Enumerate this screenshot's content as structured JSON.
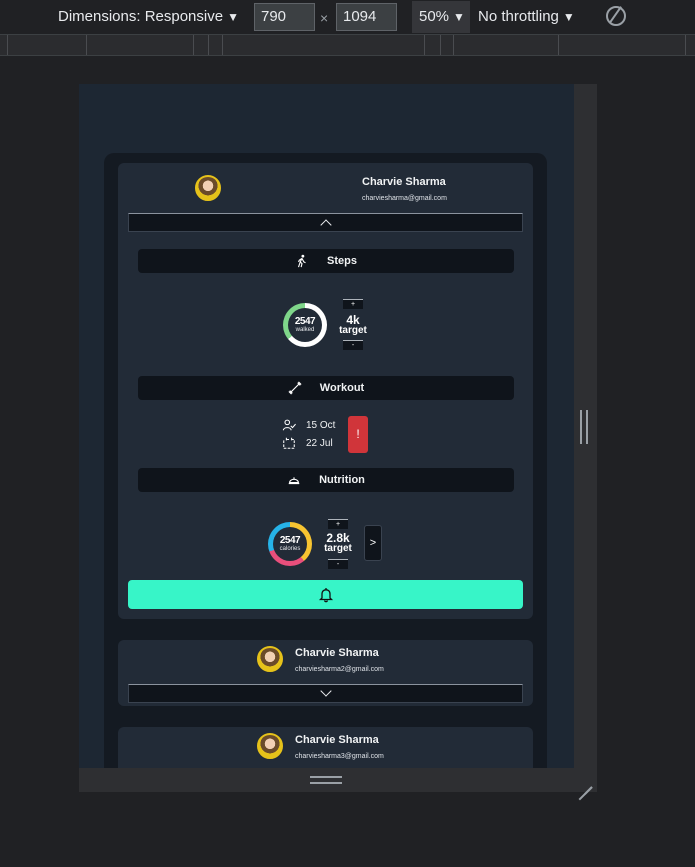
{
  "devtools": {
    "dimensions_label": "Dimensions: Responsive",
    "width": "790",
    "height": "1094",
    "times": "×",
    "zoom": "50%",
    "throttling": "No throttling",
    "caret": "▼"
  },
  "cards": [
    {
      "name": "Charvie Sharma",
      "email": "charviesharma@gmail.com",
      "expanded": true,
      "steps": {
        "title": "Steps",
        "walked_value": "2547",
        "walked_label": "walked",
        "progress": 0.64,
        "plus": "+",
        "minus": "-",
        "target_value": "4k",
        "target_label": "target"
      },
      "workout": {
        "title": "Workout",
        "date1": "15 Oct",
        "date2": "22 Jul",
        "alert": "!"
      },
      "nutrition": {
        "title": "Nutrition",
        "calories_value": "2547",
        "calories_label": "calories",
        "plus": "+",
        "minus": "-",
        "target_value": "2.8k",
        "target_label": "target",
        "next": ">",
        "ring_colors": [
          "#f7c431",
          "#e94f7c",
          "#26b3e8"
        ]
      },
      "accent_color": "#37f5c8"
    },
    {
      "name": "Charvie Sharma",
      "email": "charviesharma2@gmail.com",
      "expanded": false
    },
    {
      "name": "Charvie Sharma",
      "email": "charviesharma3@gmail.com",
      "expanded": false
    }
  ]
}
